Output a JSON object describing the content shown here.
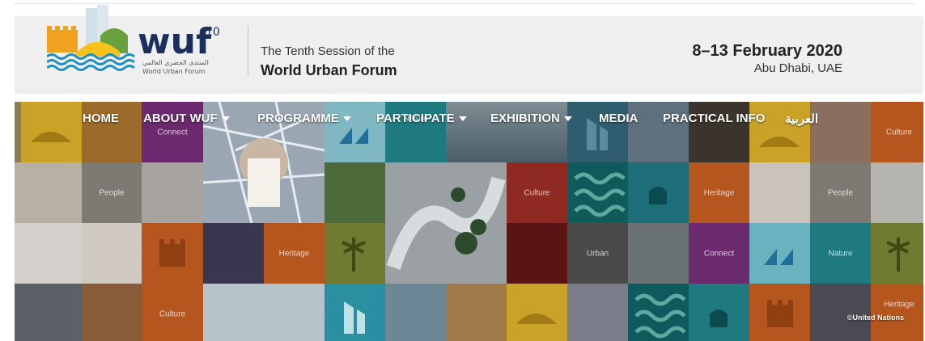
{
  "header": {
    "logo_text": "wuf",
    "logo_superscript": "10",
    "logo_arabic": "المنتدى الحضري العالمي",
    "logo_english": "World Urban Forum",
    "session_line1": "The Tenth Session of the",
    "session_line2": "World Urban Forum",
    "dates": "8–13 February 2020",
    "location": "Abu Dhabi, UAE"
  },
  "nav": {
    "items": [
      {
        "label": "HOME",
        "dropdown": false
      },
      {
        "label": "ABOUT WUF",
        "dropdown": true
      },
      {
        "label": "PROGRAMME",
        "dropdown": true
      },
      {
        "label": "PARTICIPATE",
        "dropdown": true
      },
      {
        "label": "EXHIBITION",
        "dropdown": true
      },
      {
        "label": "MEDIA",
        "dropdown": false
      },
      {
        "label": "PRACTICAL INFO",
        "dropdown": false
      },
      {
        "label": "العربية",
        "dropdown": false
      }
    ]
  },
  "banner": {
    "copyright": "©United Nations",
    "tile_labels": {
      "connect_1": "Connect",
      "nature_1": "Nature",
      "culture_1": "Culture",
      "people_1": "People",
      "culture_2": "Culture",
      "heritage_1": "Heritage",
      "people_2": "People",
      "heritage_2": "Heritage",
      "urban_1": "Urban",
      "connect_2": "Connect",
      "nature_2": "Nature",
      "culture_3": "Culture",
      "heritage_3": "Heritage"
    }
  },
  "colors": {
    "header_bg": "#efefef",
    "mustard": "#c9a227",
    "purple": "#6b2a6e",
    "teal": "#1f7a80",
    "brown_orange": "#b5561f",
    "red": "#8e2a22",
    "grey": "#7c7a73",
    "olive": "#6f7b31",
    "dark_teal": "#0e5a5c"
  }
}
